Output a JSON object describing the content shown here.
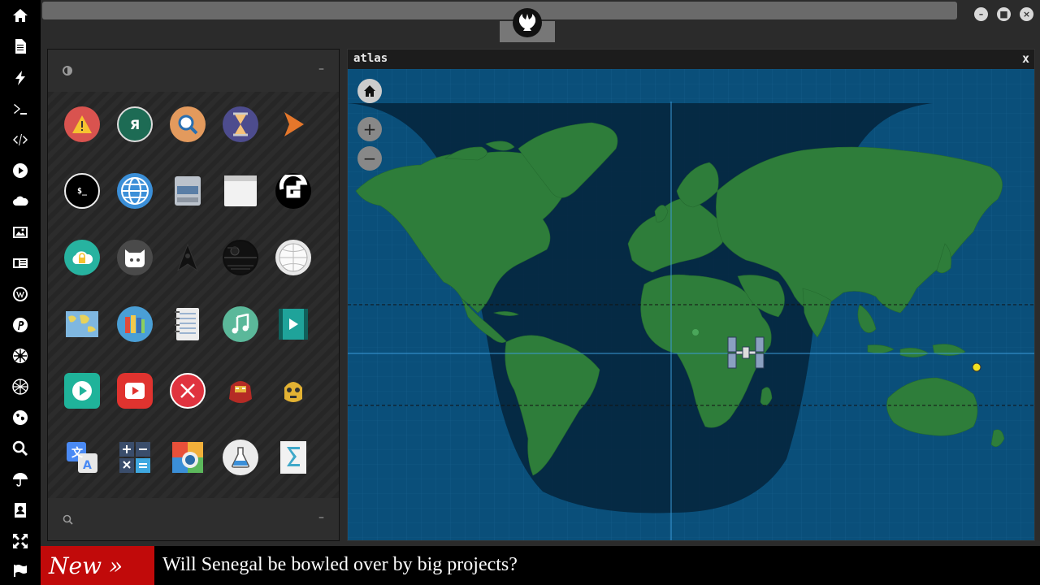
{
  "window_controls": [
    "minimize",
    "maximize",
    "close"
  ],
  "sidebar": {
    "icons": [
      "home-icon",
      "document-icon",
      "bolt-icon",
      "terminal-icon",
      "code-icon",
      "play-icon",
      "cloud-icon",
      "image-icon",
      "newspaper-icon",
      "wordpress-icon",
      "pinterest-icon",
      "rebel-icon",
      "globe-grid-icon",
      "earth-icon",
      "search-icon",
      "umbrella-icon",
      "contacts-icon",
      "expand-icon",
      "flag-icon"
    ]
  },
  "launcher": {
    "apps": [
      [
        "warning-icon",
        "yandex-icon",
        "magnifier-icon",
        "hourglass-icon",
        "arrow-icon"
      ],
      [
        "terminal-icon",
        "globe-icon",
        "scanner-icon",
        "window-icon",
        "shell-icon"
      ],
      [
        "cloud-lock-icon",
        "github-icon",
        "starfleet-icon",
        "death-star-icon",
        "wikipedia-icon"
      ],
      [
        "map-icon",
        "books-icon",
        "notebook-icon",
        "music-icon",
        "video-icon"
      ],
      [
        "play-store-icon",
        "youtube-icon",
        "x-circle-icon",
        "iron-man-icon",
        "c3po-icon"
      ],
      [
        "translate-icon",
        "calculator-icon",
        "photo-icon",
        "flask-icon",
        "sigma-icon"
      ]
    ]
  },
  "atlas": {
    "title": "atlas",
    "close_label": "x",
    "home_label": "⌂",
    "zoom_in_label": "+",
    "zoom_out_label": "−"
  },
  "ticker": {
    "badge": "New »",
    "headline": "Will Senegal be bowled over by big projects?"
  },
  "colors": {
    "land": "#2e7d3a",
    "ocean_day": "#0a4f7a",
    "ocean_night": "#072a44",
    "ticker_badge": "#c10a0a"
  }
}
